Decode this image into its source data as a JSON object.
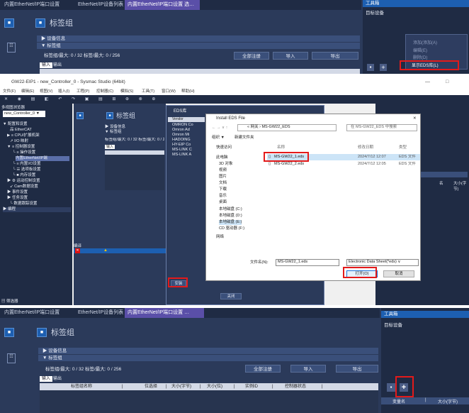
{
  "p1": {
    "tabs": [
      "内置EtherNet/IP端口设置",
      "EtherNet/IP设备列表",
      "内置EtherNet/IP端口设置 选…"
    ],
    "title": "标签组",
    "sec_device": "▶ 设备信息",
    "sec_tags": "▼ 标签组",
    "counts": "标签组/最大:  0 / 32     标签/最大:  0 / 256",
    "btn_register": "全部注册",
    "btn_import": "导入",
    "btn_export": "导出",
    "io_tabs": [
      "输入",
      "输出"
    ],
    "toolbox_title": "工具箱",
    "toolbox_item": "目标设备",
    "menu": [
      "添加(添加(A)",
      "编辑(E)",
      "删除(D)",
      "显示EDS库(L)"
    ]
  },
  "p2": {
    "window_title": "GW22-EIP1 - new_Controller_0 - Sysmac Studio (64bit)",
    "menus": [
      "文件(F)",
      "编辑(E)",
      "视图(V)",
      "插入(I)",
      "工程(P)",
      "控制器(C)",
      "模拟(S)",
      "工具(T)",
      "窗口(W)",
      "帮助(H)"
    ],
    "explorer_title": "多视图浏览器",
    "controller": "new_Controller_0 ▼",
    "tree": [
      "▼ 配置和设置",
      "品 EtherCAT",
      "▶ ≡ CPU/扩展机架",
      "↗ I/O 映射",
      "▼ ≡ 控制器设置",
      "└ ≡ 操作设置",
      "内置EtherNet/IP端",
      "└ ≡ 内置I/O设置",
      "└ ☰ 选项板设置",
      "└ ■ 内存设置",
      "▶ ⚙ 运动控制设置",
      "↙ Cam数据设置",
      "▶ 事件设置",
      "▶ 任务设置",
      "└ 数据跟踪设置",
      "▶ 编程"
    ],
    "filter": "▤ 筛选器",
    "eds_title": "EDS库",
    "eds_list": [
      "Vendor",
      "OMRON Co",
      "Omron Ad",
      "Omron Mi",
      "HADOING",
      "HY-EIP Co",
      "MS-LINK C",
      "MS-LINK A"
    ],
    "btn_install": "安装",
    "btn_close": "关闭",
    "errors_title": "编译",
    "dialog": {
      "title": "Install EDS File",
      "path": "« 网关 › MS-GW22_EDS",
      "search": "在 MS-GW22_EDS 中搜索",
      "organize": "组织 ▼",
      "newfolder": "新建文件夹",
      "nav": [
        "快速访问",
        "此电脑",
        "3D 对象",
        "视频",
        "图片",
        "文档",
        "下载",
        "音乐",
        "桌面",
        "本地磁盘 (C:)",
        "本地磁盘 (D:)",
        "本地磁盘 (E:)",
        "CD 驱动器 (F:)",
        "网络"
      ],
      "col_name": "名称",
      "col_date": "修改日期",
      "col_type": "类型",
      "files": [
        {
          "name": "MS-GW22_1.eds",
          "date": "2024/7/12 12:07",
          "type": "EDS 文件"
        },
        {
          "name": "MS-GW22_2.eds",
          "date": "2024/7/12 12:05",
          "type": "EDS 文件"
        }
      ],
      "filename_label": "文件名(N):",
      "filename_value": "MS-GW22_1.eds",
      "filter": "Electronic Data Sheet(*eds) ∨",
      "open": "打开(O)",
      "cancel": "取消"
    },
    "right_cols": [
      "名",
      "大小(字节)"
    ]
  },
  "p3": {
    "tabs": [
      "内置EtherNet/IP端口设置",
      "EtherNet/IP设备列表",
      "内置EtherNet/IP端口设置 …"
    ],
    "title": "标签组",
    "sec_device": "▶ 设备信息",
    "sec_tags": "▼ 标签组",
    "counts": "标签组/最大:  0 / 32     标签/最大:  0 / 256",
    "btn_register": "全部注册",
    "btn_import": "导入",
    "btn_export": "导出",
    "io_tabs": [
      "输入",
      "输出"
    ],
    "columns": [
      "标签组名称",
      "|",
      "位选择",
      "|",
      "大小(字节)",
      "|",
      "大小(位)",
      "|",
      "实例ID",
      "|",
      "控制器状态",
      "|"
    ],
    "toolbox_title": "工具箱",
    "toolbox_item": "目标设备",
    "right_cols": [
      "变量名",
      "|",
      "大小(字节)"
    ]
  }
}
